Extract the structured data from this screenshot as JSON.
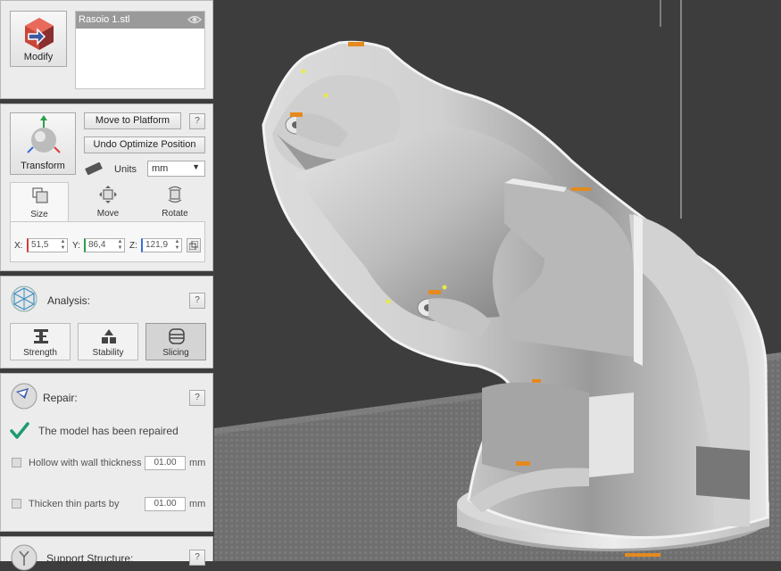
{
  "modify": {
    "label": "Modify"
  },
  "file_list": {
    "items": [
      {
        "name": "Rasoio 1.stl"
      }
    ]
  },
  "transform": {
    "label": "Transform",
    "move_to_platform": "Move to Platform",
    "undo_optimize": "Undo Optimize Position",
    "help": "?",
    "units_label": "Units",
    "units_value": "mm",
    "tabs": [
      {
        "label": "Size"
      },
      {
        "label": "Move"
      },
      {
        "label": "Rotate"
      }
    ],
    "x_label": "X:",
    "x_value": "51,5",
    "y_label": "Y:",
    "y_value": "86,4",
    "z_label": "Z:",
    "z_value": "121,9"
  },
  "analysis": {
    "title": "Analysis:",
    "help": "?",
    "buttons": [
      {
        "label": "Strength"
      },
      {
        "label": "Stability"
      },
      {
        "label": "Slicing"
      }
    ]
  },
  "repair": {
    "title": "Repair:",
    "help": "?",
    "status": "The model has been repaired",
    "hollow_label": "Hollow with wall thickness",
    "hollow_value": "01.00",
    "hollow_unit": "mm",
    "thicken_label": "Thicken thin parts by",
    "thicken_value": "01.00",
    "thicken_unit": "mm"
  },
  "support": {
    "title": "Support Structure:",
    "help": "?"
  },
  "colors": {
    "accent_check": "#1e9a70",
    "orange_marker": "#e58a1e"
  }
}
